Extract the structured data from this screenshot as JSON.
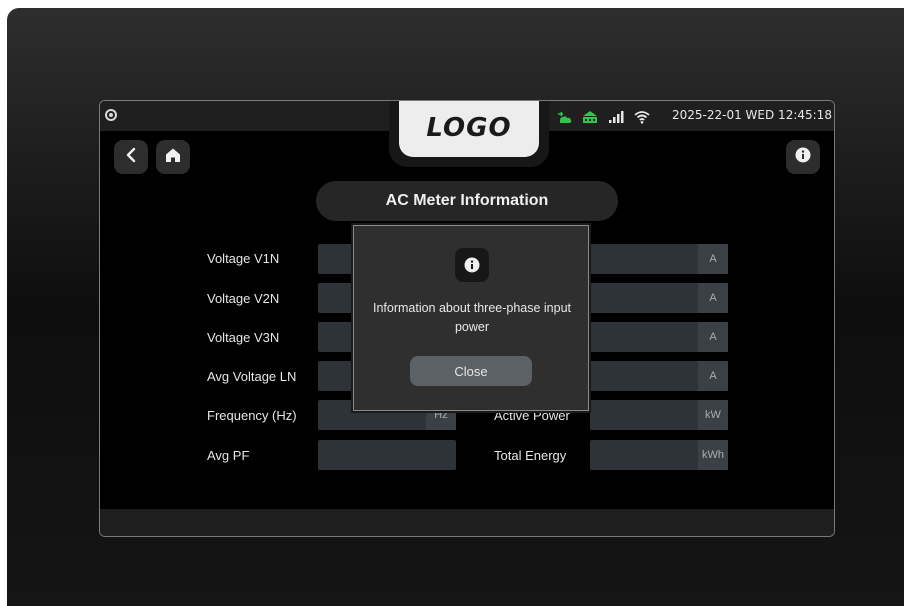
{
  "status": {
    "datetime": "2025-22-01 WED 12:45:18",
    "icons": [
      "camera-icon",
      "cloud-sync-icon",
      "network-icon",
      "signal-bars-icon",
      "wifi-icon"
    ],
    "accent_color": "#2fc44a"
  },
  "header": {
    "logo": "LOGO",
    "title": "AC Meter Information"
  },
  "nav": {
    "back_icon": "chevron-left-icon",
    "home_icon": "home-icon",
    "info_icon": "info-icon"
  },
  "left_rows": [
    {
      "label": "Voltage V1N",
      "value": "",
      "unit": ""
    },
    {
      "label": "Voltage V2N",
      "value": "",
      "unit": ""
    },
    {
      "label": "Voltage V3N",
      "value": "",
      "unit": ""
    },
    {
      "label": "Avg Voltage LN",
      "value": "",
      "unit": ""
    },
    {
      "label": "Frequency (Hz)",
      "value": "",
      "unit": "Hz"
    },
    {
      "label": "Avg PF",
      "value": "",
      "unit": ""
    }
  ],
  "right_rows": [
    {
      "label": "",
      "value": "",
      "unit": "A"
    },
    {
      "label": "",
      "value": "",
      "unit": "A"
    },
    {
      "label": "",
      "value": "",
      "unit": "A"
    },
    {
      "label": "",
      "value": "",
      "unit": "A"
    },
    {
      "label": "Active Power",
      "value": "",
      "unit": "kW"
    },
    {
      "label": "Total Energy",
      "value": "",
      "unit": "kWh"
    }
  ],
  "modal": {
    "message": "Information about three-phase input power",
    "close_label": "Close"
  }
}
